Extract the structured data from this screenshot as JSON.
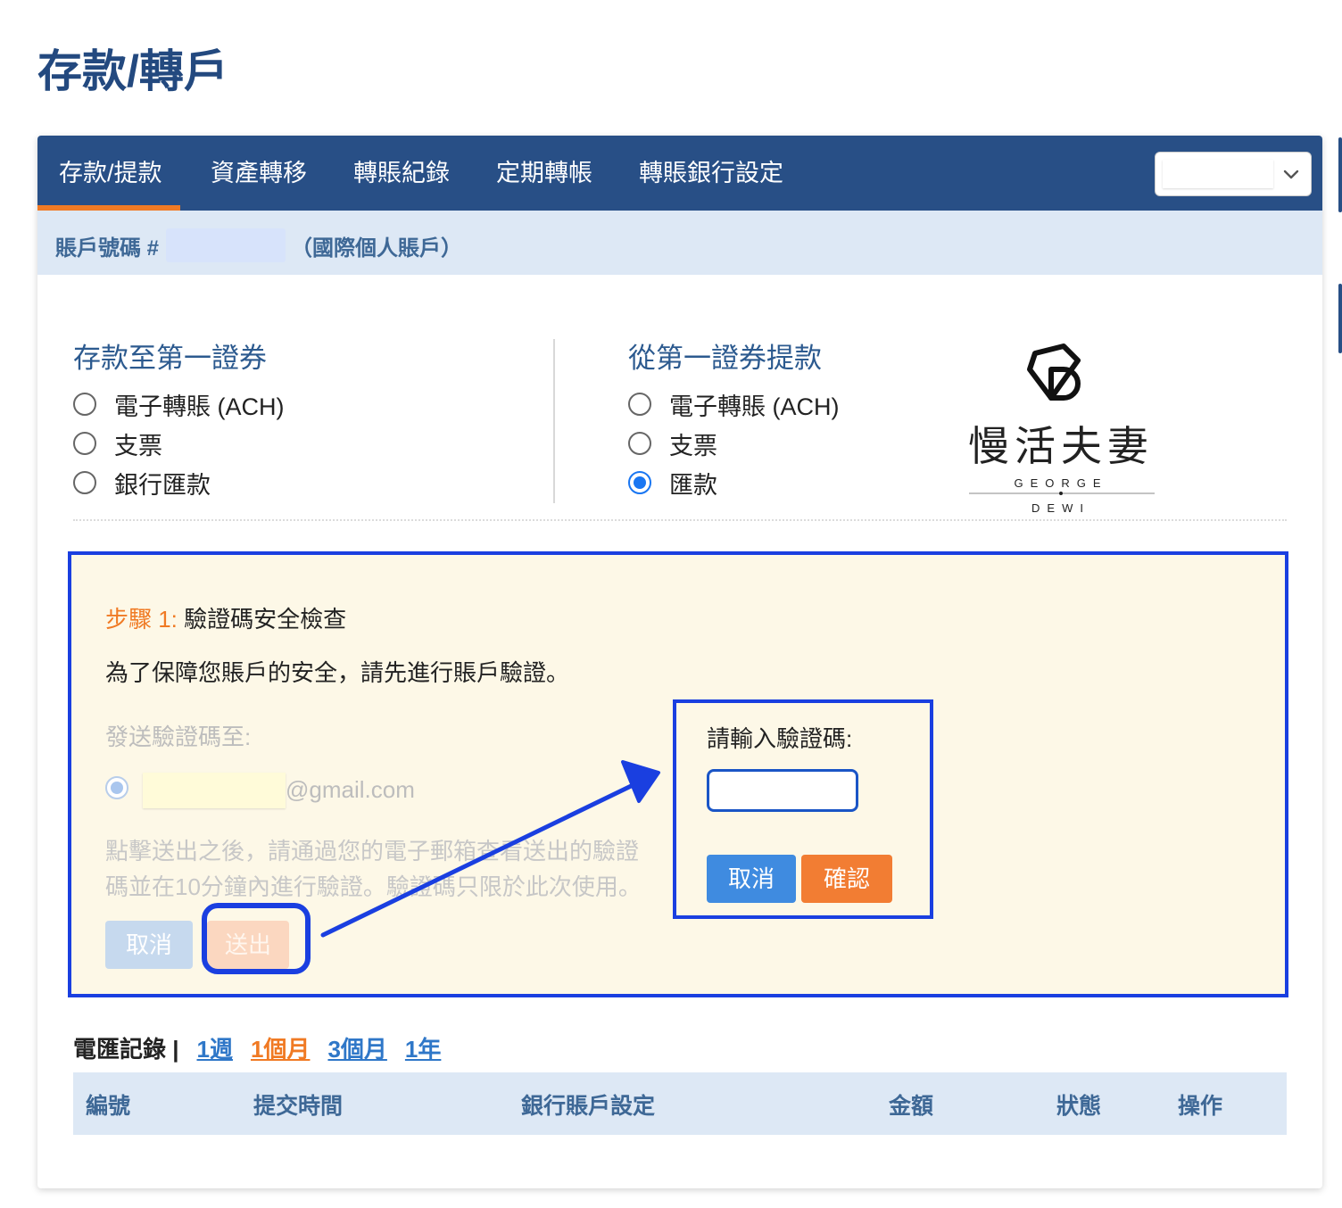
{
  "page_title": "存款/轉戶",
  "tabs": [
    {
      "label": "存款/提款",
      "active": true
    },
    {
      "label": "資產轉移"
    },
    {
      "label": "轉賬紀錄"
    },
    {
      "label": "定期轉帳"
    },
    {
      "label": "轉賬銀行設定"
    }
  ],
  "account": {
    "label": "賬戶號碼 #",
    "type": "（國際個人賬戶）"
  },
  "deposit": {
    "title": "存款至第一證券",
    "options": [
      "電子轉賬 (ACH)",
      "支票",
      "銀行匯款"
    ]
  },
  "withdraw": {
    "title": "從第一證券提款",
    "options": [
      "電子轉賬 (ACH)",
      "支票",
      "匯款"
    ],
    "selected": "匯款"
  },
  "watermark": {
    "name": "慢活夫妻",
    "line1": "GEORGE",
    "line2": "DEWI"
  },
  "step": {
    "number_label": "步驟 1:",
    "title": "驗證碼安全檢查",
    "description": "為了保障您賬戶的安全，請先進行賬戶驗證。",
    "send_to_label": "發送驗證碼至:",
    "email_domain": "@gmail.com",
    "hint": "點擊送出之後，請通過您的電子郵箱查看送出的驗證碼並在10分鐘內進行驗證。驗證碼只限於此次使用。",
    "cancel_label": "取消",
    "send_label": "送出"
  },
  "verify": {
    "label": "請輸入驗證碼:",
    "input_value": "",
    "cancel_label": "取消",
    "confirm_label": "確認"
  },
  "history": {
    "title": "電匯記錄 |",
    "ranges": [
      "1週",
      "1個月",
      "3個月",
      "1年"
    ],
    "active_range": "1個月"
  },
  "table": {
    "columns": [
      "編號",
      "提交時間",
      "銀行賬戶設定",
      "金額",
      "狀態",
      "操作"
    ]
  },
  "colors": {
    "primary": "#284f86",
    "accent": "#f07a24",
    "highlight": "#1a3fe0"
  }
}
